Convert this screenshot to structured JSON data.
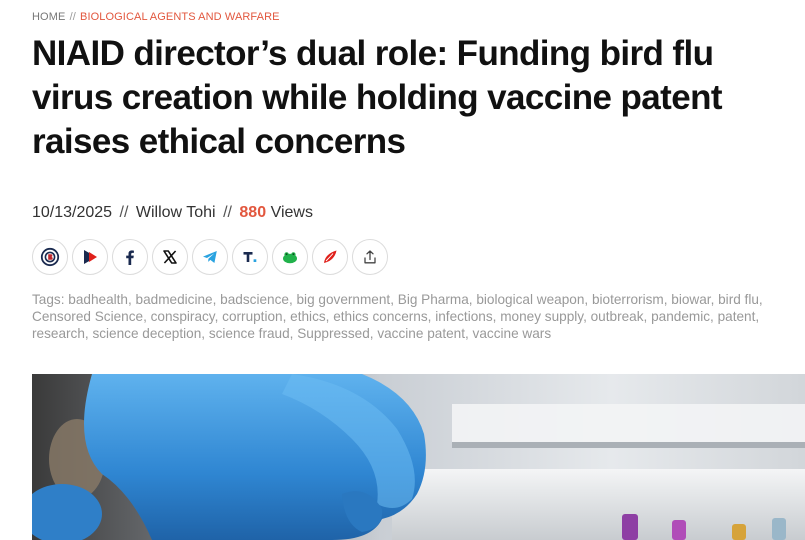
{
  "breadcrumb": {
    "home": "HOME",
    "separator": "//",
    "category": "BIOLOGICAL AGENTS AND WARFARE"
  },
  "article": {
    "title": "NIAID director’s dual role: Funding bird flu virus creation while holding vaccine patent raises ethical concerns",
    "date": "10/13/2025",
    "meta_separator": "//",
    "author": "Willow Tohi",
    "views_count": "880",
    "views_label": "Views"
  },
  "share_buttons": [
    {
      "name": "brighteon-social-share",
      "icon": "brighteon-icon"
    },
    {
      "name": "brighteon-video-share",
      "icon": "play-logo-icon"
    },
    {
      "name": "facebook-share",
      "icon": "facebook-icon"
    },
    {
      "name": "x-share",
      "icon": "x-icon"
    },
    {
      "name": "telegram-share",
      "icon": "telegram-icon"
    },
    {
      "name": "truth-social-share",
      "icon": "truth-social-icon"
    },
    {
      "name": "gab-share",
      "icon": "frog-icon"
    },
    {
      "name": "gettr-share",
      "icon": "gettr-icon"
    },
    {
      "name": "share-export",
      "icon": "share-icon"
    }
  ],
  "tags": {
    "lines": [
      "Tags: badhealth, badmedicine, badscience, big government, Big Pharma, biological weapon, bioterrorism, biowar, bird flu,",
      "Censored Science, conspiracy, corruption, ethics, ethics concerns, infections, money supply, outbreak, pandemic, patent,",
      "research, science deception, science fraud, Suppressed, vaccine patent, vaccine wars"
    ]
  },
  "colors": {
    "accent": "#e2573e",
    "glove": "#3f9be0",
    "facebook": "#1877f2",
    "telegram": "#2aa3e0",
    "gab": "#21b24b",
    "gettr": "#e0201b"
  }
}
